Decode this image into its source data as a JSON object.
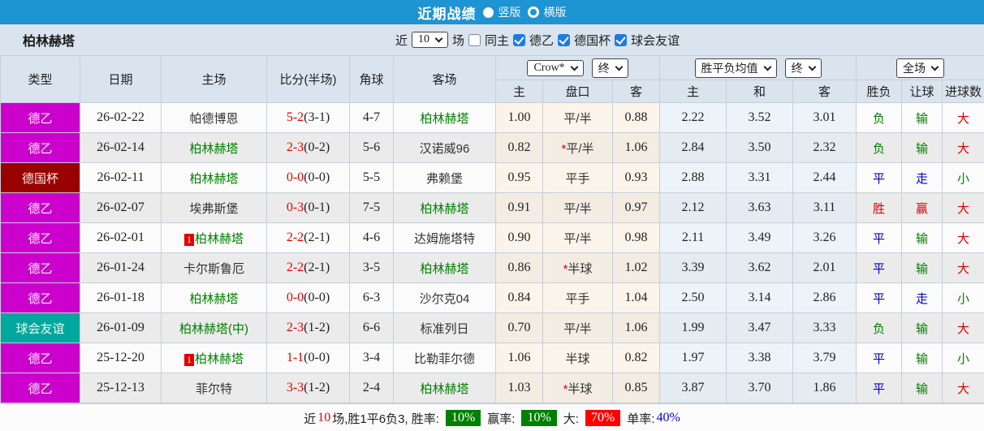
{
  "titlebar": {
    "title": "近期战绩",
    "option_vertical": "竖版",
    "option_horizontal": "横版"
  },
  "filter_bar": {
    "team": "柏林赫塔",
    "near_label": "近",
    "count_select": "10",
    "suffix": "场",
    "same_home": "同主",
    "leagues": [
      "德乙",
      "德国杯",
      "球会友谊"
    ]
  },
  "table": {
    "static_headers": [
      "类型",
      "日期",
      "主场",
      "比分(半场)",
      "角球",
      "客场"
    ],
    "group_selects": {
      "crow": "Crow*",
      "crow_time": "终",
      "avg": "胜平负均值",
      "avg_time": "终",
      "full": "全场"
    },
    "sub_headers": [
      "主",
      "盘口",
      "客",
      "主",
      "和",
      "客",
      "胜负",
      "让球",
      "进球数"
    ],
    "rows": [
      {
        "type": "德乙",
        "type_color": "league_magenta",
        "date": "26-02-22",
        "home_badge": "",
        "home": "帕德博恩",
        "home_green": false,
        "ft": "5-2",
        "ht": "(3-1)",
        "corners": "4-7",
        "away": "柏林赫塔",
        "away_green": true,
        "crow_home": "1.00",
        "handicap_prefix": "",
        "handicap": "平/半",
        "crow_away": "0.88",
        "avg_home": "2.22",
        "avg_draw": "3.52",
        "avg_away": "3.01",
        "res_wdl": "负",
        "res_wdl_color": "loss_green",
        "res_handicap": "输",
        "res_handicap_color": "loss_green",
        "res_goals": "大",
        "res_goals_color": "win_red"
      },
      {
        "type": "德乙",
        "type_color": "league_magenta",
        "date": "26-02-14",
        "home_badge": "",
        "home": "柏林赫塔",
        "home_green": true,
        "ft": "2-3",
        "ht": "(0-2)",
        "corners": "5-6",
        "away": "汉诺威96",
        "away_green": false,
        "crow_home": "0.82",
        "handicap_prefix": "*",
        "handicap": "平/半",
        "crow_away": "1.06",
        "avg_home": "2.84",
        "avg_draw": "3.50",
        "avg_away": "2.32",
        "res_wdl": "负",
        "res_wdl_color": "loss_green",
        "res_handicap": "输",
        "res_handicap_color": "loss_green",
        "res_goals": "大",
        "res_goals_color": "win_red"
      },
      {
        "type": "德国杯",
        "type_color": "cup_darkred",
        "date": "26-02-11",
        "home_badge": "",
        "home": "柏林赫塔",
        "home_green": true,
        "ft": "0-0",
        "ht": "(0-0)",
        "corners": "5-5",
        "away": "弗赖堡",
        "away_green": false,
        "crow_home": "0.95",
        "handicap_prefix": "",
        "handicap": "平手",
        "crow_away": "0.93",
        "avg_home": "2.88",
        "avg_draw": "3.31",
        "avg_away": "2.44",
        "res_wdl": "平",
        "res_wdl_color": "draw_blue",
        "res_handicap": "走",
        "res_handicap_color": "draw_blue",
        "res_goals": "小",
        "res_goals_color": "loss_green"
      },
      {
        "type": "德乙",
        "type_color": "league_magenta",
        "date": "26-02-07",
        "home_badge": "",
        "home": "埃弗斯堡",
        "home_green": false,
        "ft": "0-3",
        "ht": "(0-1)",
        "corners": "7-5",
        "away": "柏林赫塔",
        "away_green": true,
        "crow_home": "0.91",
        "handicap_prefix": "",
        "handicap": "平/半",
        "crow_away": "0.97",
        "avg_home": "2.12",
        "avg_draw": "3.63",
        "avg_away": "3.11",
        "res_wdl": "胜",
        "res_wdl_color": "win_red",
        "res_handicap": "赢",
        "res_handicap_color": "win_red",
        "res_goals": "大",
        "res_goals_color": "win_red"
      },
      {
        "type": "德乙",
        "type_color": "league_magenta",
        "date": "26-02-01",
        "home_badge": "1",
        "home": "柏林赫塔",
        "home_green": true,
        "ft": "2-2",
        "ht": "(2-1)",
        "corners": "4-6",
        "away": "达姆施塔特",
        "away_green": false,
        "crow_home": "0.90",
        "handicap_prefix": "",
        "handicap": "平/半",
        "crow_away": "0.98",
        "avg_home": "2.11",
        "avg_draw": "3.49",
        "avg_away": "3.26",
        "res_wdl": "平",
        "res_wdl_color": "draw_blue",
        "res_handicap": "输",
        "res_handicap_color": "loss_green",
        "res_goals": "大",
        "res_goals_color": "win_red"
      },
      {
        "type": "德乙",
        "type_color": "league_magenta",
        "date": "26-01-24",
        "home_badge": "",
        "home": "卡尔斯鲁厄",
        "home_green": false,
        "ft": "2-2",
        "ht": "(2-1)",
        "corners": "3-5",
        "away": "柏林赫塔",
        "away_green": true,
        "crow_home": "0.86",
        "handicap_prefix": "*",
        "handicap": "半球",
        "crow_away": "1.02",
        "avg_home": "3.39",
        "avg_draw": "3.62",
        "avg_away": "2.01",
        "res_wdl": "平",
        "res_wdl_color": "draw_blue",
        "res_handicap": "输",
        "res_handicap_color": "loss_green",
        "res_goals": "大",
        "res_goals_color": "win_red"
      },
      {
        "type": "德乙",
        "type_color": "league_magenta",
        "date": "26-01-18",
        "home_badge": "",
        "home": "柏林赫塔",
        "home_green": true,
        "ft": "0-0",
        "ht": "(0-0)",
        "corners": "6-3",
        "away": "沙尔克04",
        "away_green": false,
        "crow_home": "0.84",
        "handicap_prefix": "",
        "handicap": "平手",
        "crow_away": "1.04",
        "avg_home": "2.50",
        "avg_draw": "3.14",
        "avg_away": "2.86",
        "res_wdl": "平",
        "res_wdl_color": "draw_blue",
        "res_handicap": "走",
        "res_handicap_color": "draw_blue",
        "res_goals": "小",
        "res_goals_color": "loss_green"
      },
      {
        "type": "球会友谊",
        "type_color": "friendly_teal",
        "date": "26-01-09",
        "home_badge": "",
        "home": "柏林赫塔(中)",
        "home_green": true,
        "ft": "2-3",
        "ht": "(1-2)",
        "corners": "6-6",
        "away": "标准列日",
        "away_green": false,
        "crow_home": "0.70",
        "handicap_prefix": "",
        "handicap": "平/半",
        "crow_away": "1.06",
        "avg_home": "1.99",
        "avg_draw": "3.47",
        "avg_away": "3.33",
        "res_wdl": "负",
        "res_wdl_color": "loss_green",
        "res_handicap": "输",
        "res_handicap_color": "loss_green",
        "res_goals": "大",
        "res_goals_color": "win_red"
      },
      {
        "type": "德乙",
        "type_color": "league_magenta",
        "date": "25-12-20",
        "home_badge": "1",
        "home": "柏林赫塔",
        "home_green": true,
        "ft": "1-1",
        "ht": "(0-0)",
        "corners": "3-4",
        "away": "比勒菲尔德",
        "away_green": false,
        "crow_home": "1.06",
        "handicap_prefix": "",
        "handicap": "半球",
        "crow_away": "0.82",
        "avg_home": "1.97",
        "avg_draw": "3.38",
        "avg_away": "3.79",
        "res_wdl": "平",
        "res_wdl_color": "draw_blue",
        "res_handicap": "输",
        "res_handicap_color": "loss_green",
        "res_goals": "小",
        "res_goals_color": "loss_green"
      },
      {
        "type": "德乙",
        "type_color": "league_magenta",
        "date": "25-12-13",
        "home_badge": "",
        "home": "菲尔特",
        "home_green": false,
        "ft": "3-3",
        "ht": "(1-2)",
        "corners": "2-4",
        "away": "柏林赫塔",
        "away_green": true,
        "crow_home": "1.03",
        "handicap_prefix": "*",
        "handicap": "半球",
        "crow_away": "0.85",
        "avg_home": "3.87",
        "avg_draw": "3.70",
        "avg_away": "1.86",
        "res_wdl": "平",
        "res_wdl_color": "draw_blue",
        "res_handicap": "输",
        "res_handicap_color": "loss_green",
        "res_goals": "大",
        "res_goals_color": "win_red"
      }
    ]
  },
  "summary": {
    "prefix": "近",
    "count": "10",
    "stats_text": "场,胜1平6负3, 胜率:",
    "win_rate": "10%",
    "profit_label": "赢率:",
    "profit_rate": "10%",
    "big_label": "大:",
    "big_rate": "70%",
    "single_label": "单率:",
    "single_rate": "40%"
  },
  "colors": {
    "league_magenta": "#CC00CC",
    "cup_darkred": "#990000",
    "friendly_teal": "#00A79C",
    "win_red": "#E00000",
    "draw_blue": "#0000CC",
    "loss_green": "#008000",
    "titlebar_blue": "#1E94D2",
    "header_bg": "#DAE4EE",
    "score_red": "#E60000",
    "team_green": "#008000"
  }
}
